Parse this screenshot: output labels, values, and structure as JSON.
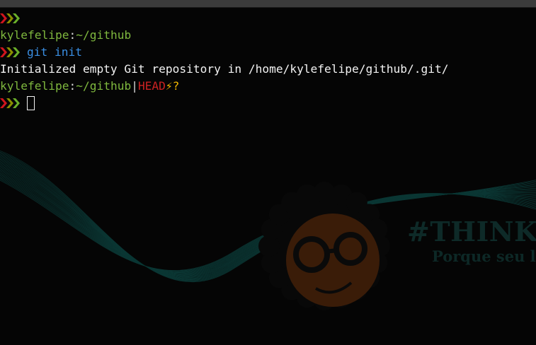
{
  "terminal": {
    "lines": [
      {
        "type": "prompt-marker"
      },
      {
        "user": "kylefelipe",
        "sep": ":",
        "path": "~/github"
      },
      {
        "command": "git init"
      },
      {
        "output": "Initialized empty Git repository in /home/kylefelipe/github/.git/"
      },
      {
        "user": "kylefelipe",
        "sep": ":",
        "path": "~/github",
        "bar": "|",
        "branch": "HEAD",
        "bolt": "⚡",
        "status": "?"
      },
      {
        "type": "input-prompt"
      }
    ]
  },
  "wallpaper": {
    "brand": "#THINK",
    "tagline": "Porque seu li"
  },
  "colors": {
    "background": "#050505",
    "chevron_red": "#d0151d",
    "chevron_olive": "#8a8f00",
    "chevron_green": "#6aaf2a",
    "user_green": "#7fb83e",
    "command_blue": "#3a8fe3",
    "branch_red": "#cc2222",
    "status_yellow": "#f5b800"
  },
  "icons": {
    "prompt": "triple-chevron-icon",
    "bolt": "lightning-bolt-icon",
    "mascot": "mascot-face-with-glasses-icon"
  }
}
